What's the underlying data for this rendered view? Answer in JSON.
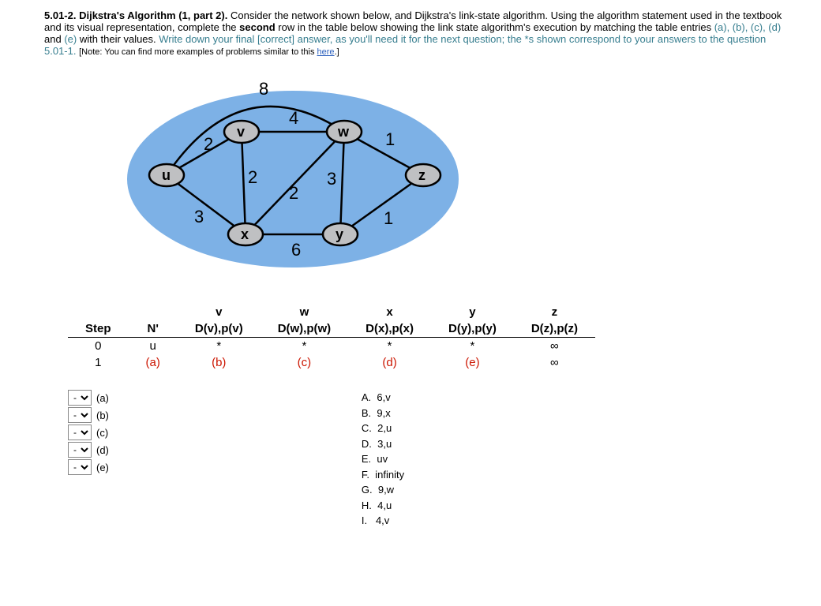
{
  "question": {
    "number_title": "5.01-2. Dijkstra's Algorithm (1, part 2).",
    "body": "  Consider the network shown below, and Dijkstra's link-state algorithm.  Using the algorithm statement used in the textbook and its visual representation, complete the ",
    "bold_word": "second",
    "body2": " row in the table below showing the link state algorithm's execution by matching the table entries ",
    "entries": "(a), (b), (c), (d)",
    "body3": " and ",
    "entry_e": "(e)",
    "body4": " with their values.  ",
    "colored": "Write down your final [correct] answer, as you'll need it for the next question; the *s shown correspond to your answers to the question 5.01-1.",
    "note_pre": " [Note: You can find more examples of problems similar to this ",
    "note_link": "here",
    "note_post": ".]"
  },
  "graph": {
    "nodes": {
      "u": "u",
      "v": "v",
      "w": "w",
      "x": "x",
      "y": "y",
      "z": "z"
    },
    "weights": {
      "uv": "2",
      "ux": "3",
      "vx": "2",
      "vw": "4",
      "wx": "2",
      "wy": "3",
      "xy": "6",
      "wz": "1",
      "yz": "1",
      "uw_top": "8"
    }
  },
  "table": {
    "col_small": {
      "v": "v",
      "w": "w",
      "x": "x",
      "y": "y",
      "z": "z"
    },
    "headers": {
      "step": "Step",
      "np": "N'",
      "dv": "D(v),p(v)",
      "dw": "D(w),p(w)",
      "dx": "D(x),p(x)",
      "dy": "D(y),p(y)",
      "dz": "D(z),p(z)"
    },
    "row0": {
      "step": "0",
      "np": "u",
      "v": "*",
      "w": "*",
      "x": "*",
      "y": "*",
      "z": "∞"
    },
    "row1": {
      "step": "1",
      "np": "(a)",
      "v": "(b)",
      "w": "(c)",
      "x": "(d)",
      "y": "(e)",
      "z": "∞"
    }
  },
  "selects": {
    "placeholder": "-",
    "labels": {
      "a": "(a)",
      "b": "(b)",
      "c": "(c)",
      "d": "(d)",
      "e": "(e)"
    }
  },
  "options": {
    "A": "A.  6,v",
    "B": "B.  9,x",
    "C": "C.  2,u",
    "D": "D.  3,u",
    "E": "E.  uv",
    "F": "F.  infinity",
    "G": "G.  9,w",
    "H": "H.  4,u",
    "I": "I.   4,v"
  }
}
